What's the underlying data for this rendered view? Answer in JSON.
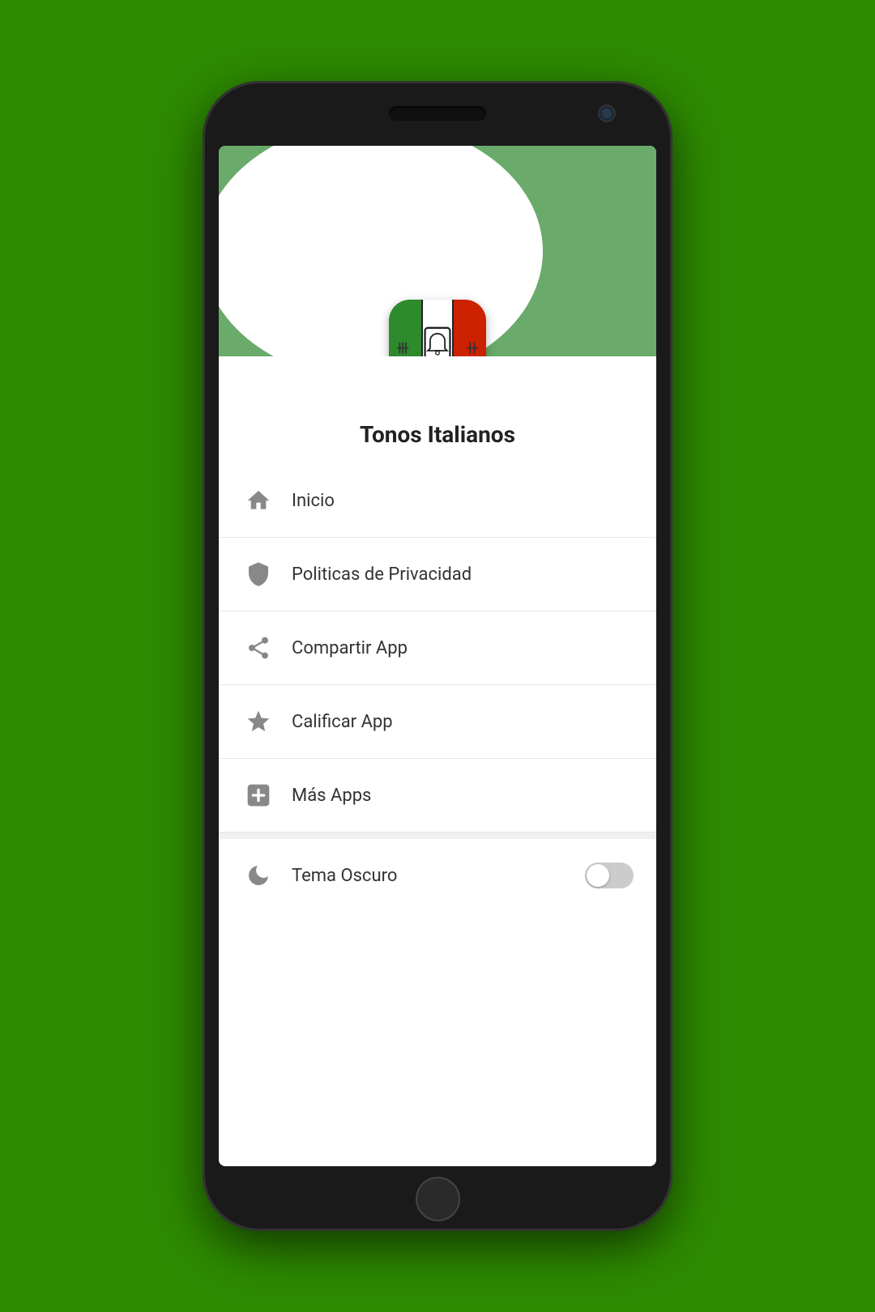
{
  "background_color": "#2e8b00",
  "app": {
    "title": "Tonos Italianos",
    "icon_alt": "Tonos Italianos app icon"
  },
  "menu": {
    "items": [
      {
        "id": "inicio",
        "label": "Inicio",
        "icon": "home"
      },
      {
        "id": "privacidad",
        "label": "Politicas de Privacidad",
        "icon": "shield"
      },
      {
        "id": "compartir",
        "label": "Compartir App",
        "icon": "share"
      },
      {
        "id": "calificar",
        "label": "Calificar App",
        "icon": "star"
      },
      {
        "id": "mas_apps",
        "label": "Más Apps",
        "icon": "plus-box"
      }
    ],
    "toggle": {
      "label": "Tema Oscuro",
      "icon": "moon",
      "enabled": false
    }
  }
}
